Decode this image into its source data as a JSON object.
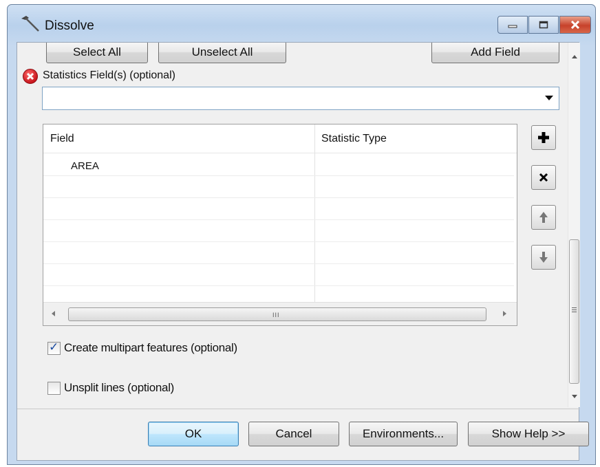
{
  "window": {
    "title": "Dissolve"
  },
  "top_buttons": {
    "select_all": "Select All",
    "unselect_all": "Unselect All",
    "add_field": "Add Field"
  },
  "statistics": {
    "label": "Statistics Field(s) (optional)",
    "combo_value": "",
    "columns": [
      "Field",
      "Statistic Type"
    ],
    "rows": [
      {
        "field": "AREA",
        "type": ""
      },
      {
        "field": "",
        "type": ""
      },
      {
        "field": "",
        "type": ""
      },
      {
        "field": "",
        "type": ""
      },
      {
        "field": "",
        "type": ""
      },
      {
        "field": "",
        "type": ""
      },
      {
        "field": "",
        "type": ""
      }
    ],
    "scroll_grip": "III"
  },
  "side_buttons": [
    "plus-icon",
    "delete-icon",
    "move-up-icon",
    "move-down-icon"
  ],
  "options": {
    "multipart": {
      "label": "Create multipart features (optional)",
      "checked": true
    },
    "unsplit": {
      "label": "Unsplit lines (optional)",
      "checked": false
    }
  },
  "footer": {
    "ok": "OK",
    "cancel": "Cancel",
    "environments": "Environments...",
    "show_help": "Show Help >>"
  },
  "colors": {
    "close_button": "#c7422b",
    "error_icon": "#c8161d",
    "titlebar": "#b9d1ec"
  }
}
